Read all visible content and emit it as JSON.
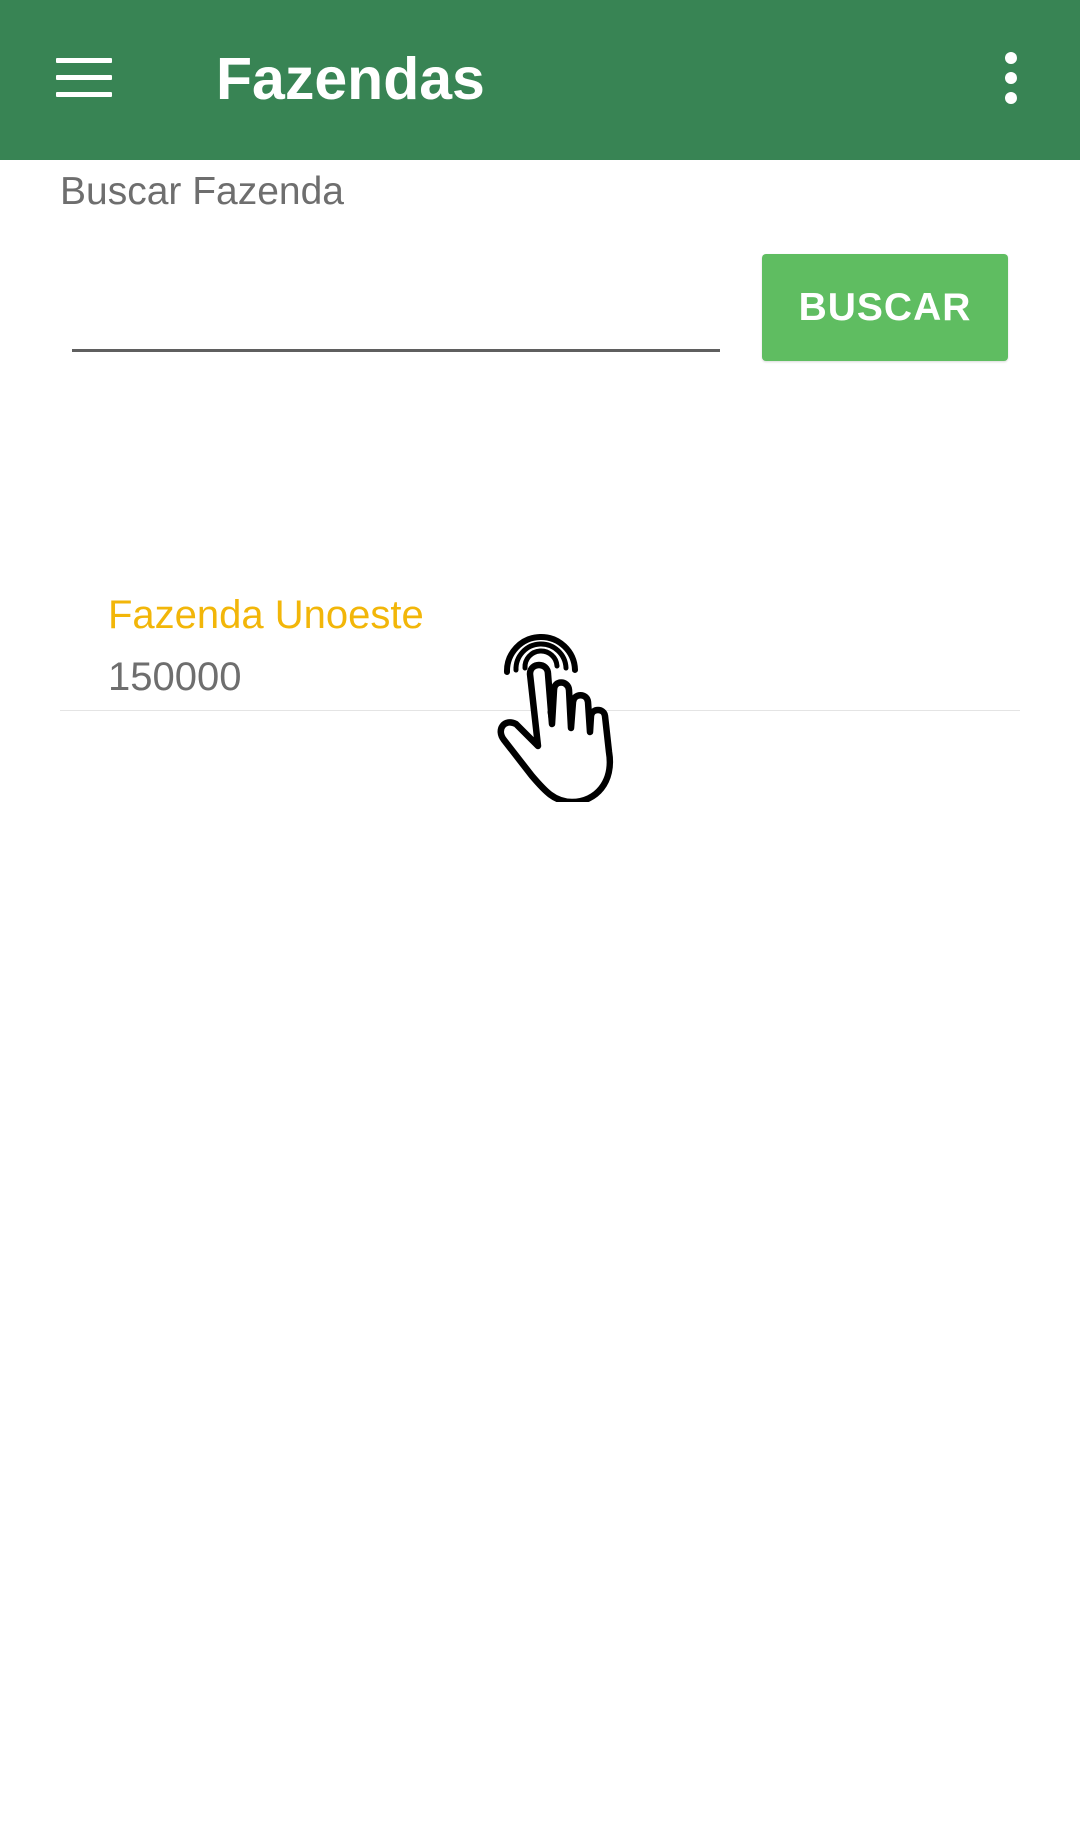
{
  "app_bar": {
    "title": "Fazendas",
    "menu_icon": "hamburger-menu-icon",
    "overflow_icon": "more-vert-icon",
    "background_color": "#388454"
  },
  "search": {
    "label": "Buscar Fazenda",
    "input_value": "",
    "button_label": "BUSCAR",
    "button_color": "#5fbd61"
  },
  "farms": [
    {
      "name": "Fazenda Unoeste",
      "value": "150000",
      "name_color": "#f2b609"
    }
  ],
  "overlay": {
    "icon": "tap-gesture-hand-icon"
  }
}
